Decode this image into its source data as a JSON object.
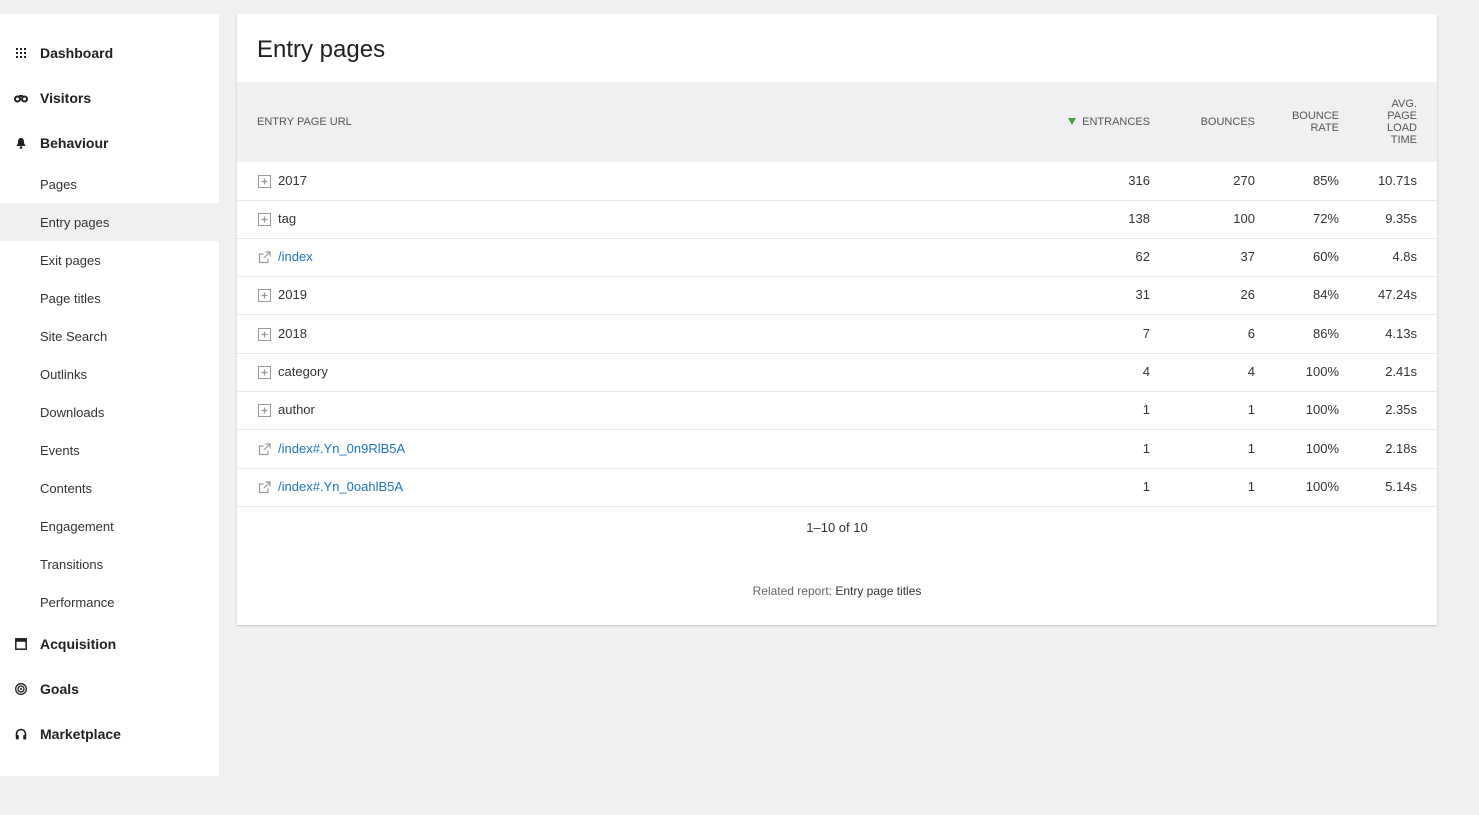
{
  "sidebar": {
    "sections": [
      {
        "label": "Dashboard",
        "icon": "grid-icon"
      },
      {
        "label": "Visitors",
        "icon": "binoculars-icon"
      },
      {
        "label": "Behaviour",
        "icon": "bell-icon"
      },
      {
        "label": "Acquisition",
        "icon": "calendar-icon"
      },
      {
        "label": "Goals",
        "icon": "target-icon"
      },
      {
        "label": "Marketplace",
        "icon": "headphones-icon"
      }
    ],
    "behaviour_items": [
      {
        "label": "Pages"
      },
      {
        "label": "Entry pages",
        "active": true
      },
      {
        "label": "Exit pages"
      },
      {
        "label": "Page titles"
      },
      {
        "label": "Site Search"
      },
      {
        "label": "Outlinks"
      },
      {
        "label": "Downloads"
      },
      {
        "label": "Events"
      },
      {
        "label": "Contents"
      },
      {
        "label": "Engagement"
      },
      {
        "label": "Transitions"
      },
      {
        "label": "Performance"
      }
    ]
  },
  "report": {
    "title": "Entry pages",
    "columns": {
      "label": "ENTRY PAGE URL",
      "entrances": "ENTRANCES",
      "bounces": "BOUNCES",
      "bounce_rate_1": "BOUNCE",
      "bounce_rate_2": "RATE",
      "load_1": "AVG.",
      "load_2": "PAGE",
      "load_3": "LOAD",
      "load_4": "TIME"
    },
    "rows": [
      {
        "label": "2017",
        "type": "folder",
        "entrances": "316",
        "bounces": "270",
        "bounce_rate": "85%",
        "load_time": "10.71s"
      },
      {
        "label": "tag",
        "type": "folder",
        "entrances": "138",
        "bounces": "100",
        "bounce_rate": "72%",
        "load_time": "9.35s"
      },
      {
        "label": "/index",
        "type": "link",
        "entrances": "62",
        "bounces": "37",
        "bounce_rate": "60%",
        "load_time": "4.8s"
      },
      {
        "label": "2019",
        "type": "folder",
        "entrances": "31",
        "bounces": "26",
        "bounce_rate": "84%",
        "load_time": "47.24s"
      },
      {
        "label": "2018",
        "type": "folder",
        "entrances": "7",
        "bounces": "6",
        "bounce_rate": "86%",
        "load_time": "4.13s"
      },
      {
        "label": "category",
        "type": "folder",
        "entrances": "4",
        "bounces": "4",
        "bounce_rate": "100%",
        "load_time": "2.41s"
      },
      {
        "label": "author",
        "type": "folder",
        "entrances": "1",
        "bounces": "1",
        "bounce_rate": "100%",
        "load_time": "2.35s"
      },
      {
        "label": "/index#.Yn_0n9RlB5A",
        "type": "link",
        "entrances": "1",
        "bounces": "1",
        "bounce_rate": "100%",
        "load_time": "2.18s"
      },
      {
        "label": "/index#.Yn_0oahlB5A",
        "type": "link",
        "entrances": "1",
        "bounces": "1",
        "bounce_rate": "100%",
        "load_time": "5.14s"
      }
    ],
    "pagination": "1–10 of 10",
    "related_prefix": "Related report: ",
    "related_link": "Entry page titles"
  },
  "colors": {
    "accent": "#43a047",
    "link": "#1e73be",
    "background": "#eff0f1"
  }
}
